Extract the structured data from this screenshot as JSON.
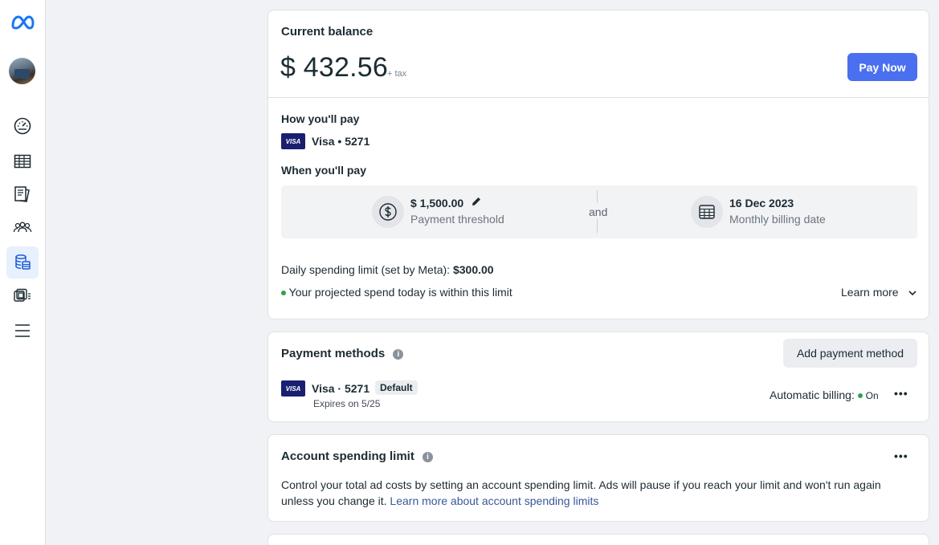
{
  "rail": {
    "items": [
      {
        "icon": "dashboard-icon"
      },
      {
        "icon": "table-icon"
      },
      {
        "icon": "pages-icon"
      },
      {
        "icon": "audience-icon"
      },
      {
        "icon": "billing-icon",
        "active": true
      },
      {
        "icon": "catalog-icon"
      },
      {
        "icon": "menu-icon"
      }
    ]
  },
  "balance": {
    "title": "Current balance",
    "amount": "$ 432.56",
    "tax": "+ tax",
    "pay_button": "Pay Now"
  },
  "how_pay": {
    "title": "How you'll pay",
    "card_brand": "VISA",
    "card_label": "Visa • 5271"
  },
  "when_pay": {
    "title": "When you'll pay",
    "threshold_value": "$ 1,500.00",
    "threshold_label": "Payment threshold",
    "and_text": "and",
    "billing_date": "16 Dec 2023",
    "billing_label": "Monthly billing date"
  },
  "daily_limit": {
    "label": "Daily spending limit (set by Meta): ",
    "value": "$300.00",
    "projected": "Your projected spend today is within this limit",
    "learn_more": "Learn more"
  },
  "payment_methods": {
    "title": "Payment methods",
    "add_button": "Add payment method",
    "card_brand": "VISA",
    "card_label": "Visa · 5271",
    "default_badge": "Default",
    "expires": "Expires on 5/25",
    "auto_billing_label": "Automatic billing:",
    "auto_billing_status": "On"
  },
  "spending_limit": {
    "title": "Account spending limit",
    "description": "Control your total ad costs by setting an account spending limit. Ads will pause if you reach your limit and won't run again unless you change it. ",
    "link": "Learn more about account spending limits"
  },
  "colors": {
    "accent": "#4a70f0",
    "status_green": "#31a24c",
    "visa_navy": "#1a1f71"
  }
}
